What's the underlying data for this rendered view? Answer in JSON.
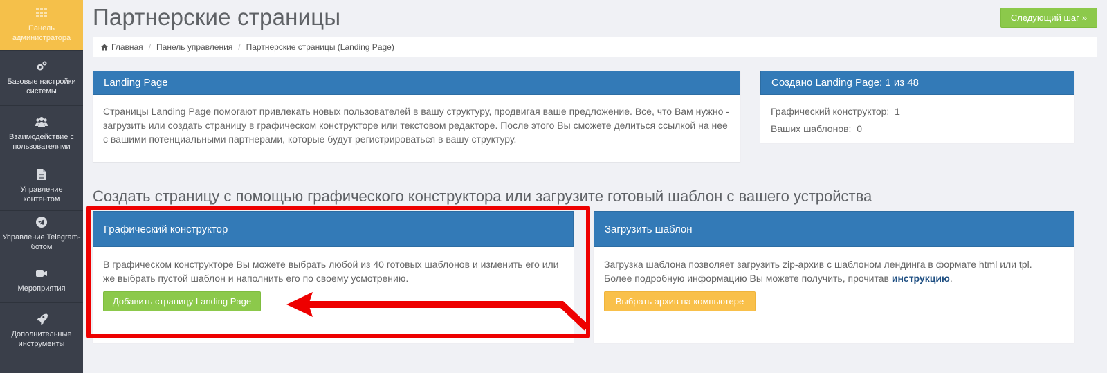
{
  "sidebar": {
    "items": [
      {
        "label": "Панель администратора",
        "icon": "grid-icon"
      },
      {
        "label": "Базовые настройки системы",
        "icon": "gears-icon"
      },
      {
        "label": "Взаимодействие с пользователями",
        "icon": "users-icon"
      },
      {
        "label": "Управление контентом",
        "icon": "document-icon"
      },
      {
        "label": "Управление Telegram-ботом",
        "icon": "telegram-icon"
      },
      {
        "label": "Мероприятия",
        "icon": "video-camera-icon"
      },
      {
        "label": "Дополнительные инструменты",
        "icon": "rocket-icon"
      }
    ]
  },
  "header": {
    "title": "Партнерские страницы",
    "next_button": "Следующий шаг"
  },
  "breadcrumb": [
    "Главная",
    "Панель управления",
    "Партнерские страницы (Landing Page)"
  ],
  "landing_panel": {
    "title": "Landing Page",
    "text": "Страницы Landing Page помогают привлекать новых пользователей в вашу структуру, продвигая ваше предложение. Все, что Вам нужно - загрузить или создать страницу в графическом конструкторе или текстовом редакторе. После этого Вы сможете делиться ссылкой на нее с вашими потенциальными партнерами, которые будут регистрироваться в вашу структуру."
  },
  "stats_panel": {
    "title": "Создано Landing Page: 1 из 48",
    "rows": [
      {
        "label": "Графический конструктор:",
        "value": "1"
      },
      {
        "label": "Ваших шаблонов:",
        "value": "0"
      }
    ]
  },
  "section_title": "Создать страницу с помощью графического конструктора или загрузите готовый шаблон с вашего устройства",
  "constructor_panel": {
    "title": "Графический конструктор",
    "text": "В графическом конструкторе Вы можете выбрать любой из 40 готовых шаблонов и изменить его или же выбрать пустой шаблон и наполнить его по своему усмотрению.",
    "button": "Добавить страницу Landing Page"
  },
  "upload_panel": {
    "title": "Загрузить шаблон",
    "text_line1": "Загрузка шаблона позволяет загрузить zip-архив с шаблоном лендинга в формате html или tpl.",
    "text_line2": "Более подробную информацию Вы можете получить, прочитав",
    "link": "инструкцию",
    "text_end": ".",
    "button": "Выбрать архив на компьютере"
  },
  "colors": {
    "panel_header": "#337ab7",
    "green_button": "#8cc94b",
    "yellow_button": "#f9c04a",
    "sidebar": "#3a3f4a",
    "sidebar_active": "#f5c04a",
    "annotation": "#ee0000"
  }
}
